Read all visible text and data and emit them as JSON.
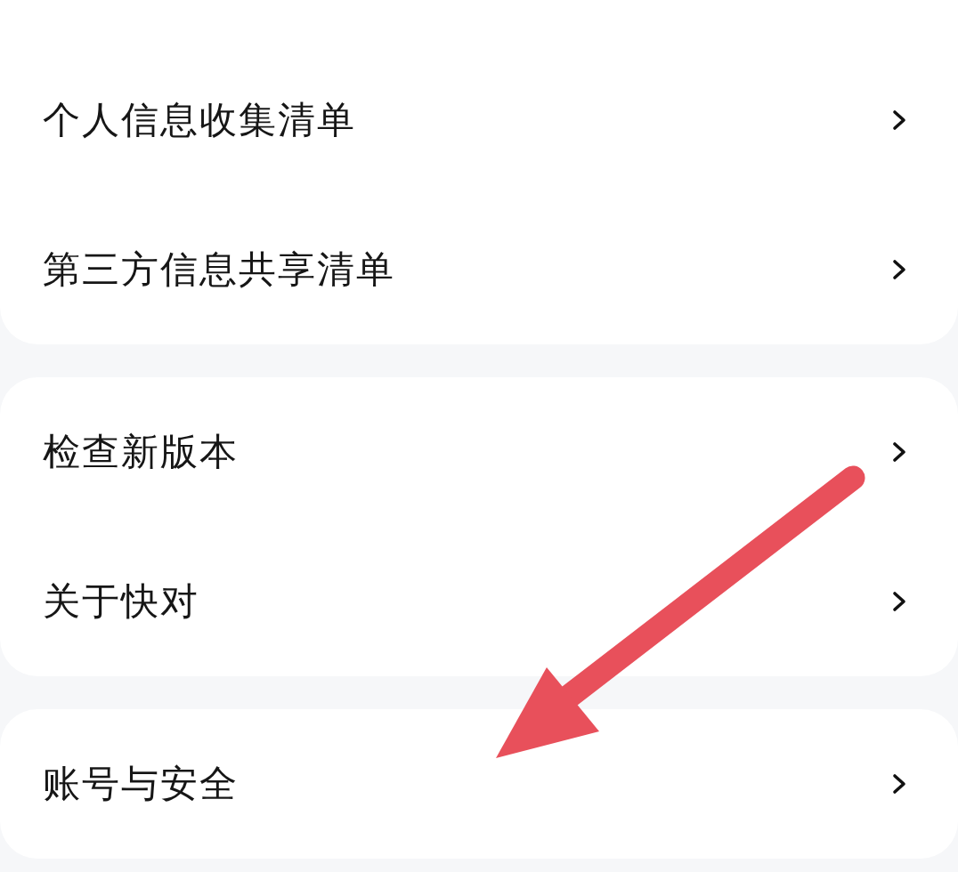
{
  "sections": [
    {
      "items": [
        {
          "label": "个人信息收集清单"
        },
        {
          "label": "第三方信息共享清单"
        }
      ]
    },
    {
      "items": [
        {
          "label": "检查新版本"
        },
        {
          "label": "关于快对"
        }
      ]
    },
    {
      "items": [
        {
          "label": "账号与安全"
        }
      ]
    }
  ],
  "annotations": [
    {
      "kind": "arrow"
    }
  ]
}
